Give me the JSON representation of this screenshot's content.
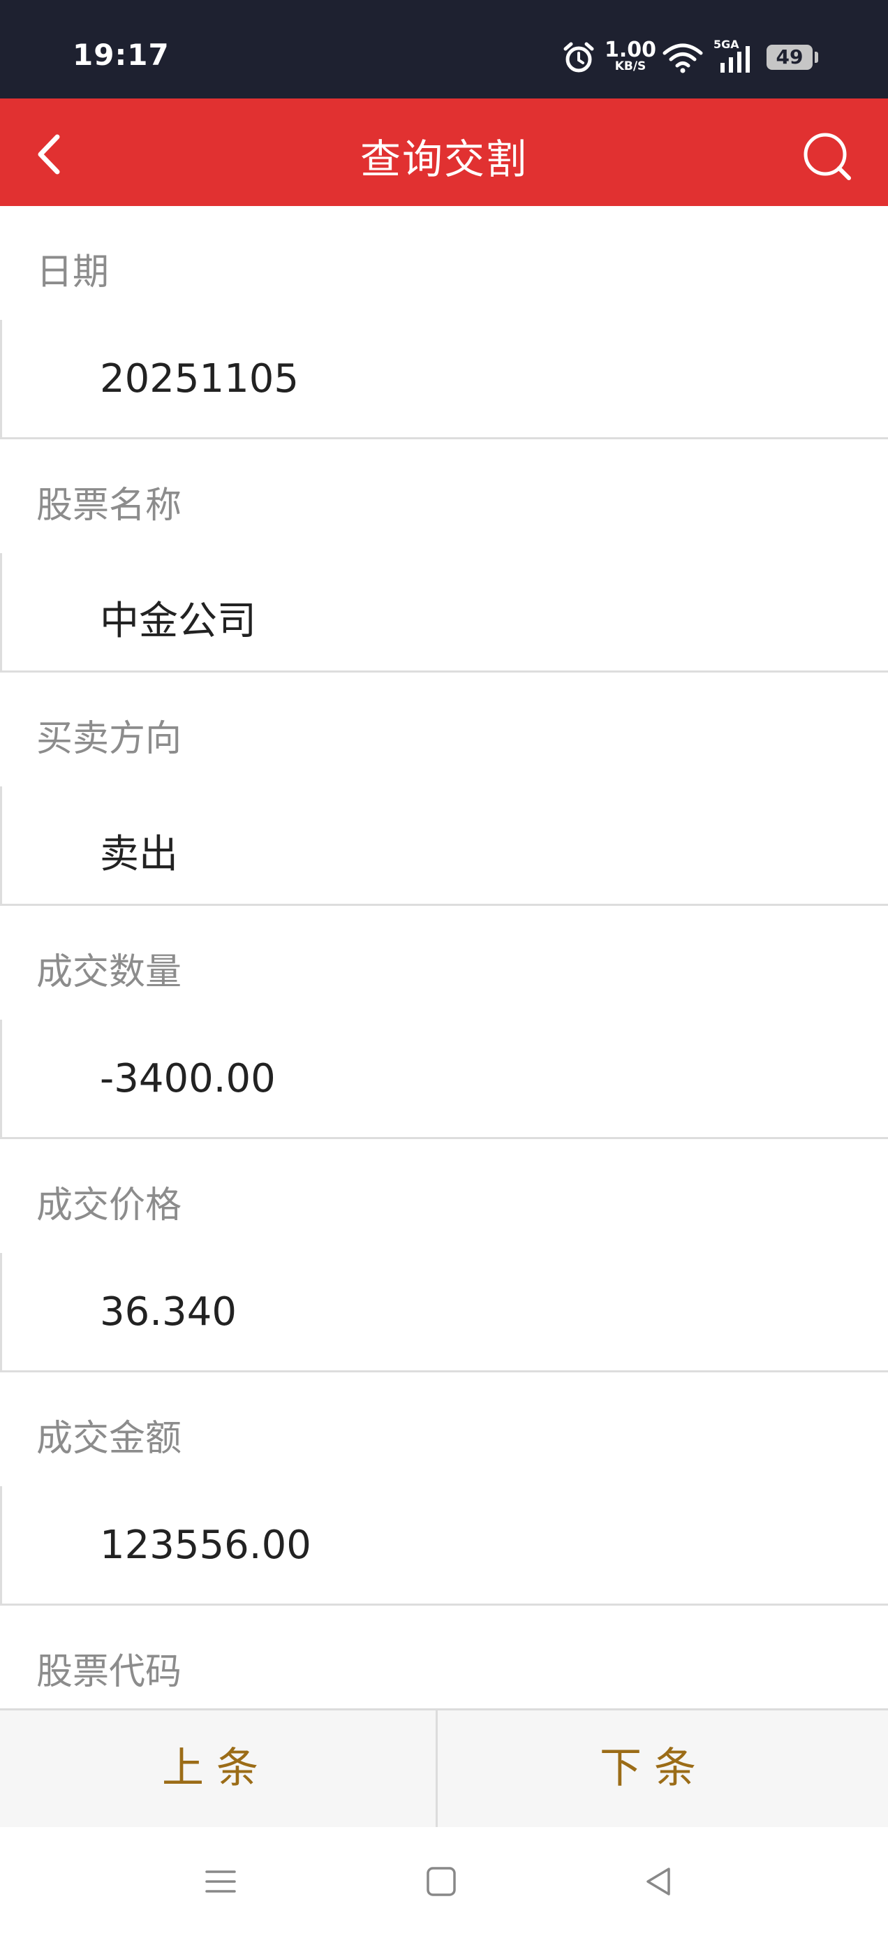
{
  "status_bar": {
    "time": "19:17",
    "network_speed_value": "1.00",
    "network_speed_unit": "KB/S",
    "signal_label": "5GA",
    "battery_level": "49"
  },
  "nav": {
    "title": "查询交割",
    "back_icon": "chevron-left-icon",
    "search_icon": "search-icon"
  },
  "fields": [
    {
      "label": "日期",
      "value": "20251105"
    },
    {
      "label": "股票名称",
      "value": "中金公司"
    },
    {
      "label": "买卖方向",
      "value": "卖出"
    },
    {
      "label": "成交数量",
      "value": "-3400.00"
    },
    {
      "label": "成交价格",
      "value": "36.340"
    },
    {
      "label": "成交金额",
      "value": "123556.00"
    },
    {
      "label": "股票代码",
      "value": ""
    }
  ],
  "footer": {
    "prev_label": "上条",
    "next_label": "下条"
  },
  "colors": {
    "nav_red": "#e13131",
    "status_bar_dark": "#1e2130",
    "footer_text_gold": "#9b6c17",
    "label_gray": "#8c8c8c"
  }
}
